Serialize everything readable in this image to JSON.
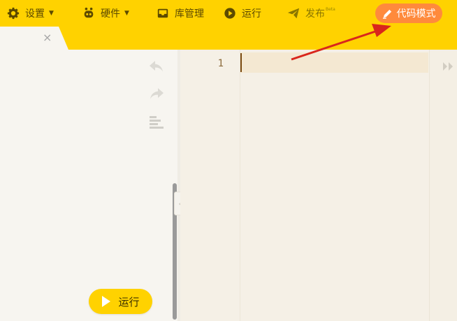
{
  "menu": {
    "settings": {
      "label": "设置",
      "icon": "gear-icon"
    },
    "hardware": {
      "label": "硬件",
      "icon": "robot-icon"
    },
    "library": {
      "label": "库管理",
      "icon": "inbox-icon"
    },
    "run": {
      "label": "运行",
      "icon": "play-circle-icon"
    },
    "publish": {
      "label": "发布",
      "badge": "Beta",
      "icon": "paper-plane-icon"
    },
    "code_mode": {
      "label": "代码模式",
      "icon": "pencil-icon"
    }
  },
  "tab": {
    "close_symbol": "×"
  },
  "workspace": {
    "icons": [
      "undo-icon",
      "redo-icon",
      "align-icon"
    ],
    "run_button": {
      "label": "运行",
      "icon": "play-icon"
    }
  },
  "editor": {
    "line_numbers": [
      "1"
    ],
    "content": ""
  },
  "colors": {
    "toolbar_bg": "#ffd200",
    "code_mode_bg": "#ff8a3c",
    "annotation_arrow": "#d9261c",
    "editor_bg": "#f5f0e6"
  }
}
